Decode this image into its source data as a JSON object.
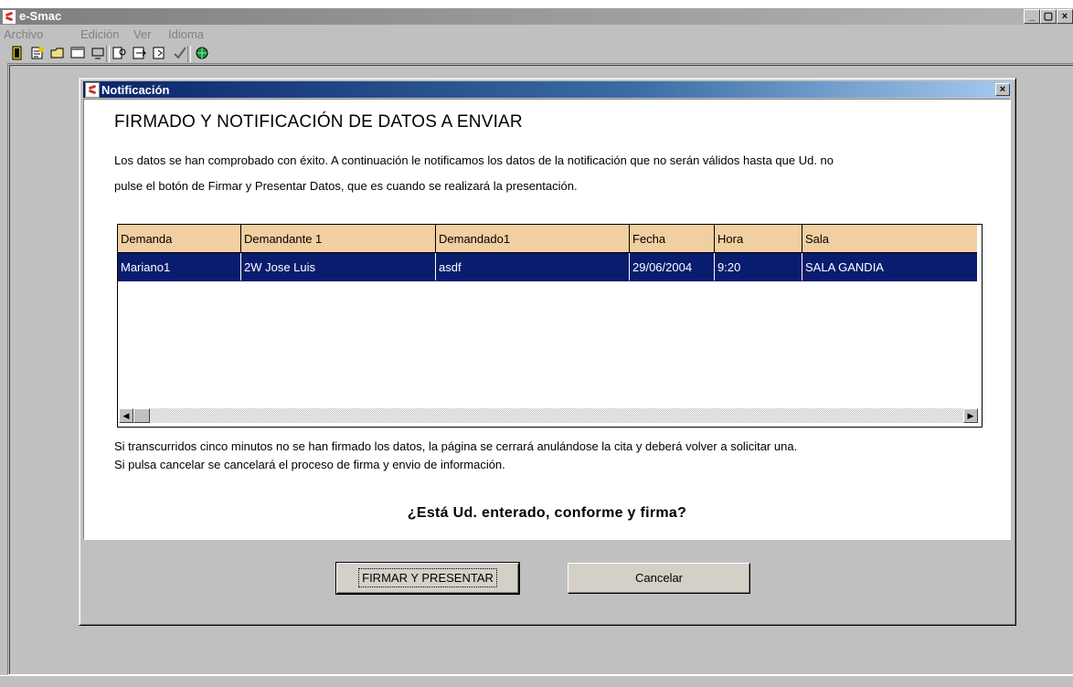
{
  "app": {
    "title": "e-Smac",
    "menu": [
      "Archivo",
      "Edición",
      "Ver",
      "Idioma"
    ]
  },
  "toolbar": {
    "icons": [
      "exit-icon",
      "edit-icon",
      "open-folder-icon",
      "window-icon",
      "find-icon",
      "export-icon",
      "import-icon",
      "check-icon",
      "network-icon"
    ]
  },
  "dialog": {
    "title": "Notificación",
    "heading": "FIRMADO Y NOTIFICACIÓN DE DATOS A ENVIAR",
    "intro_line1": "Los datos se han comprobado con éxito. A continuación le notificamos los datos de la notificación que no serán válidos hasta que Ud. no",
    "intro_line2": "pulse el botón de Firmar y Presentar Datos, que es cuando se realizará la presentación.",
    "table": {
      "columns": [
        "Demanda",
        "Demandante 1",
        "Demandado1",
        "Fecha",
        "Hora",
        "Sala"
      ],
      "rows": [
        [
          "Mariano1",
          "2W Jose Luis",
          "asdf",
          "29/06/2004",
          "9:20",
          "SALA GANDIA"
        ]
      ]
    },
    "note_line1": "Si transcurridos cinco minutos no se han firmado los datos, la página se cerrará anulándose la cita y deberá volver a solicitar una.",
    "note_line2": "Si pulsa cancelar se cancelará el proceso de firma y envio de información.",
    "question": "¿Está Ud. enterado, conforme y firma?",
    "sign_button": "FIRMAR Y PRESENTAR",
    "cancel_button": "Cancelar"
  },
  "colors": {
    "header_bg": "#f2cfa0",
    "selected_row_bg": "#0a1c6e",
    "dialog_title_bg": "#0a246a"
  }
}
